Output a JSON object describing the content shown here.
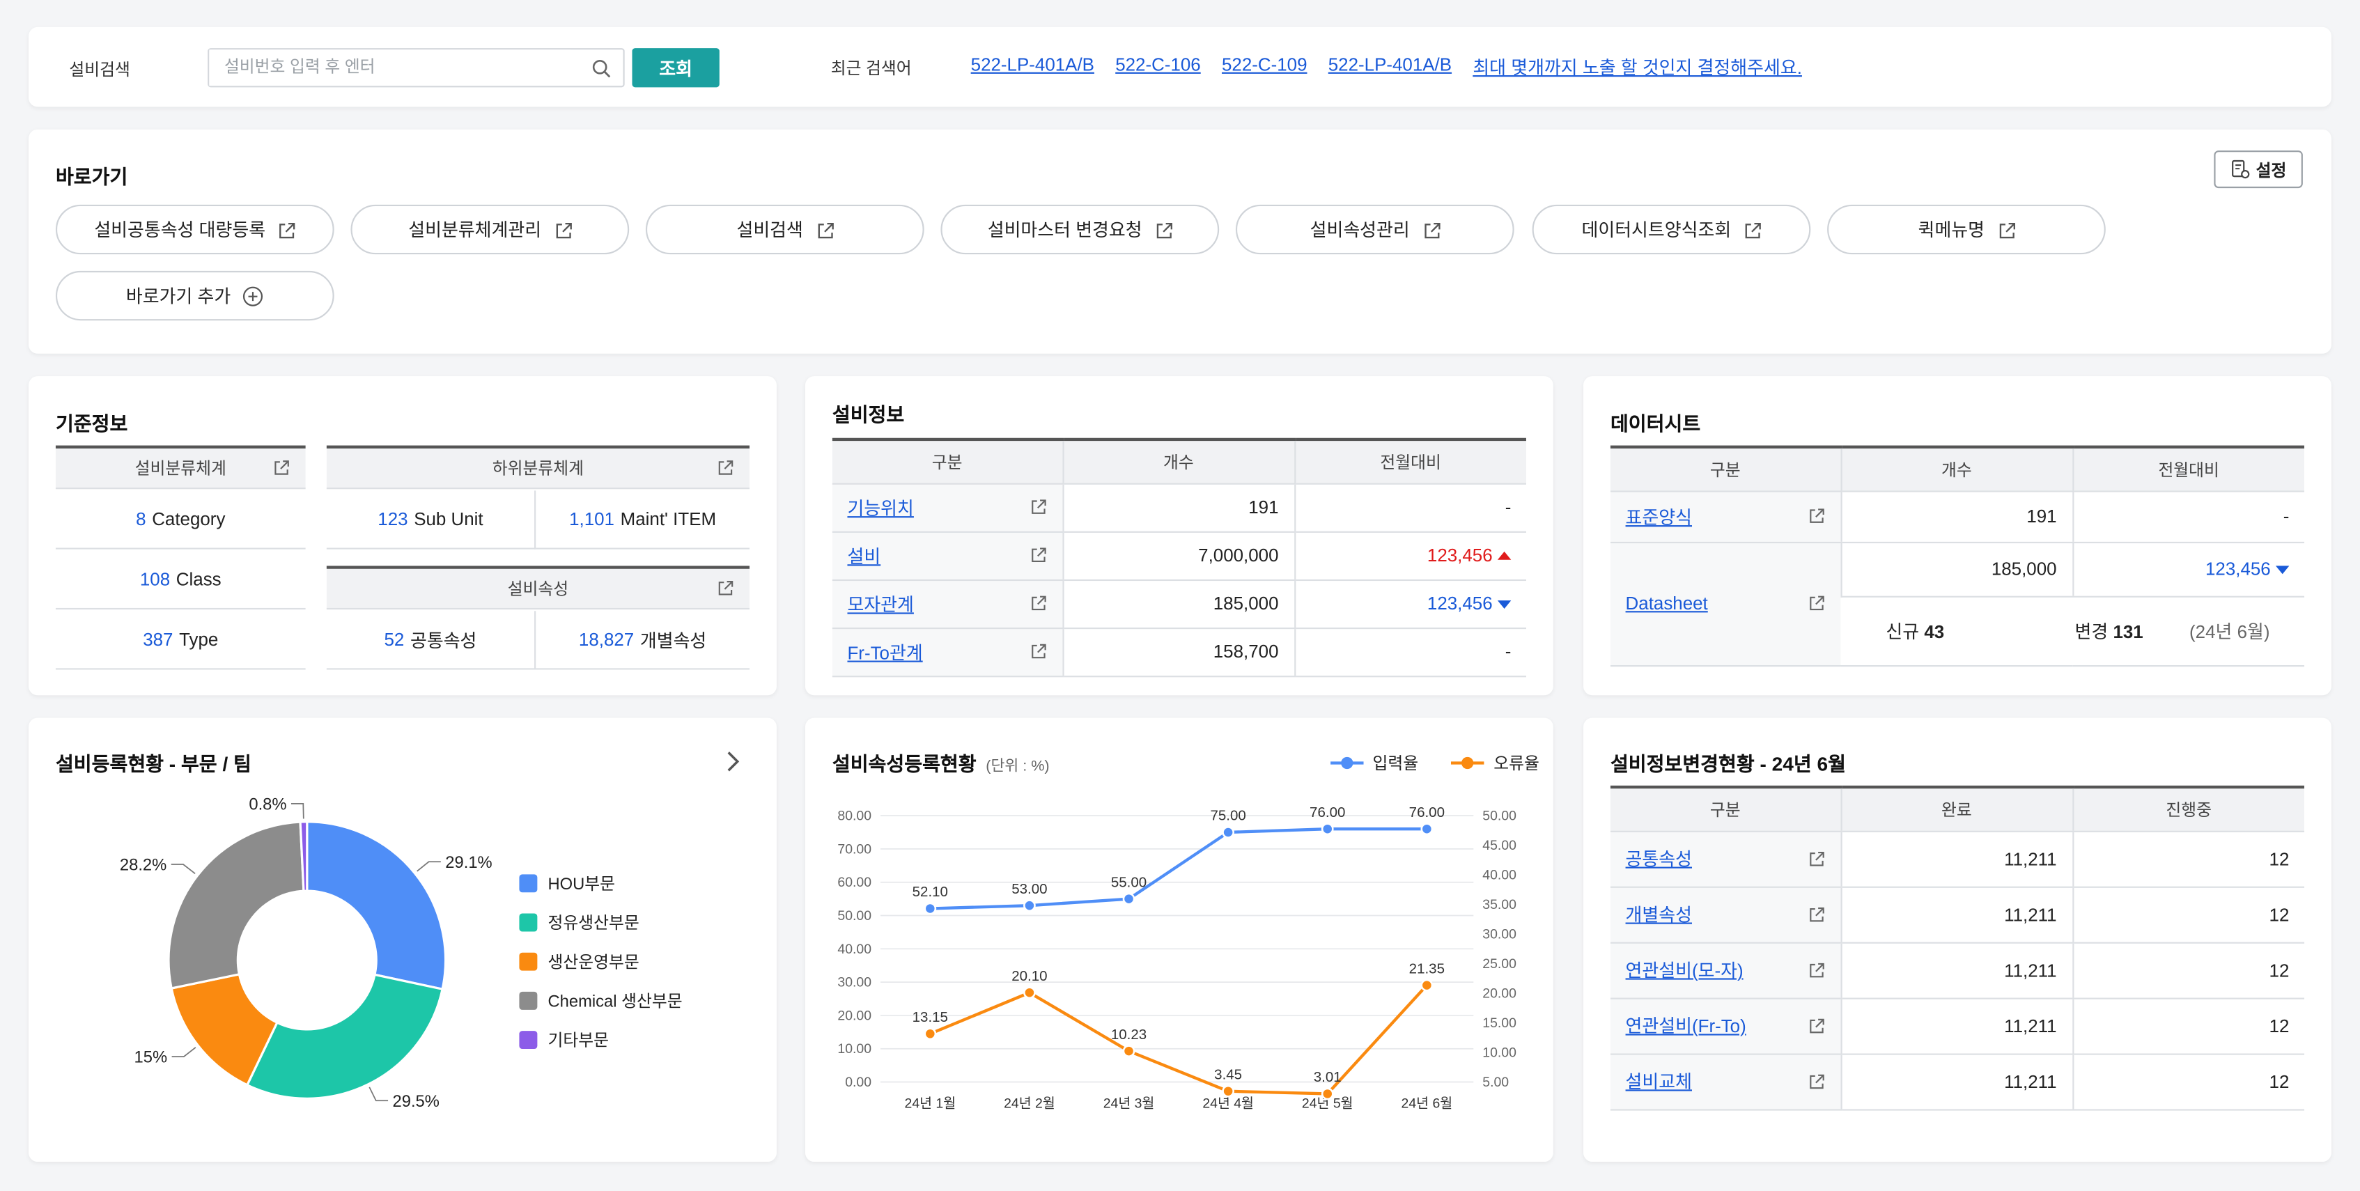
{
  "search": {
    "label": "설비검색",
    "placeholder": "설비번호 입력 후 엔터",
    "button": "조회",
    "recent_label": "최근 검색어",
    "recent": [
      "522-LP-401A/B",
      "522-C-106",
      "522-C-109",
      "522-LP-401A/B",
      "최대 몇개까지 노출 할 것인지 결정해주세요."
    ]
  },
  "shortcuts": {
    "title": "바로가기",
    "settings": "설정",
    "items": [
      "설비공통속성 대량등록",
      "설비분류체계관리",
      "설비검색",
      "설비마스터 변경요청",
      "설비속성관리",
      "데이터시트양식조회",
      "퀵메뉴명"
    ],
    "add": "바로가기 추가"
  },
  "base_info": {
    "title": "기준정보",
    "class_header": "설비분류체계",
    "sub_header": "하위분류체계",
    "attr_header": "설비속성",
    "category_num": "8",
    "category_label": "Category",
    "class_num": "108",
    "class_label": "Class",
    "type_num": "387",
    "type_label": "Type",
    "subunit_num": "123",
    "subunit_label": "Sub Unit",
    "maint_num": "1,101",
    "maint_label": "Maint' ITEM",
    "common_num": "52",
    "common_label": "공통속성",
    "indiv_num": "18,827",
    "indiv_label": "개별속성"
  },
  "equip_info": {
    "title": "설비정보",
    "headers": [
      "구분",
      "개수",
      "전월대비"
    ],
    "rows": [
      {
        "name": "기능위치",
        "count": "191",
        "diff": "-"
      },
      {
        "name": "설비",
        "count": "7,000,000",
        "diff": "123,456"
      },
      {
        "name": "모자관계",
        "count": "185,000",
        "diff": "123,456"
      },
      {
        "name": "Fr-To관계",
        "count": "158,700",
        "diff": "-"
      }
    ]
  },
  "datasheet": {
    "title": "데이터시트",
    "headers": [
      "구분",
      "개수",
      "전월대비"
    ],
    "row1": {
      "name": "표준양식",
      "count": "191",
      "diff": "-"
    },
    "row2": {
      "name": "Datasheet",
      "count": "185,000",
      "diff": "123,456"
    },
    "new_label": "신규",
    "new_num": "43",
    "change_label": "변경",
    "change_num": "131",
    "period": "(24년 6월)"
  },
  "reg_status": {
    "title": "설비등록현황 - 부문 / 팀",
    "legend": [
      "HOU부문",
      "정유생산부문",
      "생산운영부문",
      "Chemical 생산부문",
      "기타부문"
    ],
    "labels": [
      "29.1%",
      "29.5%",
      "15%",
      "28.2%",
      "0.8%"
    ],
    "colors": [
      "#4f8ef7",
      "#1dc6a8",
      "#fa8a10",
      "#8c8c8c",
      "#8c5ce8"
    ]
  },
  "chart_data": {
    "type": "line",
    "title": "설비속성등록현황",
    "subtitle": "(단위 : %)",
    "categories": [
      "24년 1월",
      "24년 2월",
      "24년 3월",
      "24년 4월",
      "24년 5월",
      "24년 6월"
    ],
    "series": [
      {
        "name": "입력율",
        "values": [
          52.1,
          53.0,
          55.0,
          75.0,
          76.0,
          76.0
        ],
        "color": "#4f8ef7",
        "axis": "left"
      },
      {
        "name": "오류율",
        "values": [
          13.15,
          20.1,
          10.23,
          3.45,
          3.01,
          21.35
        ],
        "color": "#fa8a10",
        "axis": "right"
      }
    ],
    "left_ticks": [
      "80.00",
      "70.00",
      "60.00",
      "50.00",
      "40.00",
      "30.00",
      "20.00",
      "10.00",
      "0.00"
    ],
    "right_ticks": [
      "50.00",
      "45.00",
      "40.00",
      "35.00",
      "30.00",
      "25.00",
      "20.00",
      "15.00",
      "10.00",
      "5.00"
    ],
    "ylim_left": [
      0,
      80
    ],
    "ylim_right": [
      5,
      50
    ],
    "legend_position": "top-right"
  },
  "change_status": {
    "title": "설비정보변경현황 - 24년 6월",
    "headers": [
      "구분",
      "완료",
      "진행중"
    ],
    "rows": [
      {
        "name": "공통속성",
        "done": "11,211",
        "ing": "12"
      },
      {
        "name": "개별속성",
        "done": "11,211",
        "ing": "12"
      },
      {
        "name": "연관설비(모-자)",
        "done": "11,211",
        "ing": "12"
      },
      {
        "name": "연관설비(Fr-To)",
        "done": "11,211",
        "ing": "12"
      },
      {
        "name": "설비교체",
        "done": "11,211",
        "ing": "12"
      }
    ]
  }
}
